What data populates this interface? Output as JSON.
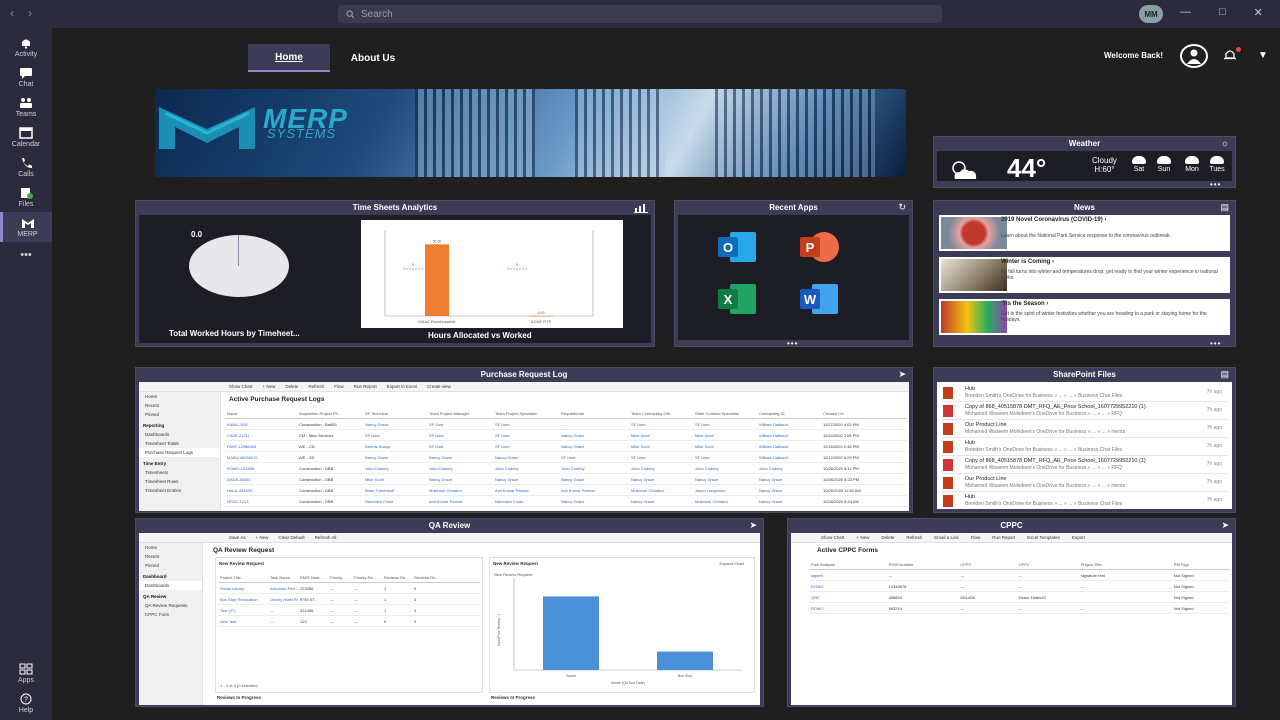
{
  "search": {
    "placeholder": "Search"
  },
  "user": {
    "initials": "MM"
  },
  "rail": [
    {
      "label": "Activity",
      "icon": "bell-icon"
    },
    {
      "label": "Chat",
      "icon": "chat-icon"
    },
    {
      "label": "Teams",
      "icon": "teams-icon"
    },
    {
      "label": "Calendar",
      "icon": "calendar-icon"
    },
    {
      "label": "Calls",
      "icon": "phone-icon"
    },
    {
      "label": "Files",
      "icon": "files-icon"
    },
    {
      "label": "MERP",
      "icon": "merp-icon"
    },
    {
      "label": "Apps",
      "icon": "apps-icon"
    },
    {
      "label": "Help",
      "icon": "help-icon"
    }
  ],
  "nav": {
    "home": "Home",
    "about": "About Us"
  },
  "header": {
    "welcome": "Welcome Back!"
  },
  "banner": {
    "brand": "MERP",
    "sub": "SYSTEMS"
  },
  "weather": {
    "title": "Weather",
    "temp": "44°",
    "condition": "Cloudy",
    "high": "H:60°",
    "forecast": [
      "Sat",
      "Sun",
      "Mon",
      "Tues"
    ]
  },
  "timesheets": {
    "title": "Time Sheets Analytics",
    "pie_value": "0.0",
    "pie_title": "Total Worked Hours by Timeheet...",
    "bar_title": "Hours Allocated vs Worked",
    "chart_data": {
      "type": "bar",
      "categories": [
        "MAAC Reimbursable",
        "ACHE RTS"
      ],
      "series": [
        {
          "name": "",
          "values": [
            50,
            0.1
          ]
        }
      ],
      "annotations": [
        "0",
        "0",
        "50.00",
        "0.00"
      ],
      "ylim": [
        0,
        60
      ]
    }
  },
  "recent_apps": {
    "title": "Recent Apps",
    "apps": [
      {
        "name": "Outlook",
        "letter": "O",
        "color": "#0f6cbd"
      },
      {
        "name": "PowerPoint",
        "letter": "P",
        "color": "#c43e1c"
      },
      {
        "name": "Excel",
        "letter": "X",
        "color": "#107c41"
      },
      {
        "name": "Word",
        "letter": "W",
        "color": "#185abd"
      }
    ]
  },
  "news": {
    "title": "News",
    "items": [
      {
        "headline": "2019 Novel Coronavirus (COVID-19) ›",
        "desc": "Learn about the National Park Service response to the coronavirus outbreak."
      },
      {
        "headline": "Winter is Coming ›",
        "desc": "As fall turns into winter and temperatures drop, get ready to find your winter experience in national parks."
      },
      {
        "headline": "'Tis the Season ›",
        "desc": "Get in the spirit of winter festivities whether you are heading to a park or staying home for the holidays."
      }
    ]
  },
  "purchase": {
    "title": "Purchase Request Log",
    "view": "Active Purchase Request Logs",
    "commands": [
      "Show Chart",
      "+ New",
      "Delete",
      "Refresh",
      "Flow",
      "Run Report",
      "Export to Excel",
      "Create view"
    ],
    "sidebar": [
      "Home",
      "Recent",
      "Pinned",
      "Reporting",
      "Dashboards",
      "Timesheet Totals",
      "Purchase Request Logs",
      "Time Entry",
      "Timesheets",
      "Timesheet Rows",
      "Timesheet Entries"
    ],
    "columns": [
      "Name",
      "Acquisition Project Ph...",
      "SF Technical",
      "Team Project Manager",
      "Team Project Specialist",
      "Requisitioner",
      "Team Contracting Offi...",
      "State Contract Specialist",
      "Contracting ID",
      "Created On"
    ],
    "rows": [
      [
        "KABA-7452",
        "Construction - Ba655",
        "Nancy Grace",
        "SF User",
        "SF User",
        "---",
        "SF User",
        "SF User",
        "William Dalbault",
        "11/27/2020 4:03 PM"
      ],
      [
        "CAVE-21211",
        "CM - Misc Services",
        "SF User",
        "SF User",
        "SF User",
        "Nancy Grace",
        "Mike Scott",
        "Mike Scott",
        "William Dalbault",
        "11/24/2020 1:06 PM"
      ],
      [
        "PAVE-12986455",
        "A/E - CD",
        "Dennis Knapp",
        "SF User",
        "SF User",
        "Nancy Grace",
        "Mike Scott",
        "Mike Scott",
        "William Dalbault",
        "11/16/2020 2:46 PM"
      ],
      [
        "MABU-45000070",
        "A/E - SD",
        "Nancy Grace",
        "Nancy Grace",
        "Nancy Grace",
        "SF User",
        "SF User",
        "SF User",
        "William Dalbault",
        "11/12/2020 6:29 PM"
      ],
      [
        "ROMO-123456",
        "Construction - DBB",
        "John Chaney",
        "John Chaney",
        "John Chaney",
        "John Chaney",
        "John Chaney",
        "John Chaney",
        "John Chaney",
        "10/26/2020 8:11 PM"
      ],
      [
        "DADA-45464",
        "Construction - DBB",
        "Mike Scott",
        "Nancy Grace",
        "Nancy Grace",
        "Nancy Grace",
        "Nancy Grace",
        "Nancy Grace",
        "Nancy Grace",
        "10/26/2020 8:23 PM"
      ],
      [
        "HALA-45464S",
        "Construction - DBB",
        "Brian Turkenhoff",
        "Mukbosh Chhabra",
        "Anil Kumar Parmar",
        "Anil Kumar Parmar",
        "Mukbosh Chhabra",
        "Jason Longshore",
        "Nancy Grace",
        "10/26/2020 11:50 AM"
      ],
      [
        "HPDC-1214",
        "Construction - DBB",
        "Narendra Chute",
        "Anil Kumar Parmar",
        "Narendra Chute",
        "Nancy Grace",
        "Nancy Grace",
        "Mukbosh Chhabra",
        "Nancy Grace",
        "10/26/2020 8:44 AM"
      ]
    ]
  },
  "sharepoint": {
    "title": "SharePoint Files",
    "items": [
      {
        "name": "Hub",
        "sub": "Brenden Smith's OneDrive for Business » ... » ... » Business Chat Files",
        "time": "7h ago",
        "type": "ppt"
      },
      {
        "name": "Copy of 868_40515878 DMT_RFQ_AE_Price School_1607729952210 (1)",
        "sub": "Mohamed Waseem Mohideen's OneDrive for Business » ... » ... » RFQ",
        "time": "7h ago",
        "type": "pdf"
      },
      {
        "name": "Our Product Line",
        "sub": "Mohamed Waseem Mohideen's OneDrive for Business » ... » ... » ments",
        "time": "7h ago",
        "type": "ppt"
      },
      {
        "name": "Hub",
        "sub": "Brenden Smith's OneDrive for Business » ... » ... » Business Chat Files",
        "time": "7h ago",
        "type": "ppt"
      },
      {
        "name": "Copy of 868_40515878 DMT_RFQ_AE_Price School_1607729952210 (1)",
        "sub": "Mohamed Waseem Mohideen's OneDrive for Business » ... » ... » RFQ",
        "time": "7h ago",
        "type": "pdf"
      },
      {
        "name": "Our Product Line",
        "sub": "Mohamed Waseem Mohideen's OneDrive for Business » ... » ... » ments",
        "time": "7h ago",
        "type": "ppt"
      },
      {
        "name": "Hub",
        "sub": "Brenden Smith's OneDrive for Business » ... » ... » Business Chat Files",
        "time": "7h ago",
        "type": "ppt"
      }
    ]
  },
  "qa": {
    "title": "QA Review",
    "view": "QA Review Request",
    "commands": [
      "Save As",
      "+ New",
      "Clear Default",
      "Refresh All"
    ],
    "sidebar": [
      "Home",
      "Recent",
      "Pinned",
      "Dashboard",
      "Dashboards",
      "QA Review",
      "QA Review Requests",
      "CPPC Form"
    ],
    "panel_left": "New Review Request",
    "panel_right": "New Review Request",
    "expand": "Expand Chart",
    "columns": [
      "Project Title",
      "Task Name",
      "PMIS Num...",
      "Priority",
      "Priority Re...",
      "Reviews Re...",
      "Reviews Re..."
    ],
    "rows": [
      [
        "Social Library",
        "Advocate Fert...",
        "123456",
        "---",
        "---",
        "1",
        "0"
      ],
      [
        "Bus Stop Renovation",
        "Disney Hotel Re...",
        "RTM ET...",
        "---",
        "---",
        "1",
        "0"
      ],
      [
        "Test (47)",
        "---",
        "321456",
        "---",
        "---",
        "1",
        "0"
      ],
      [
        "New Test",
        "---",
        "123",
        "---",
        "---",
        "0",
        "0"
      ]
    ],
    "count": "1 - 4 of 4 (0 selected)",
    "bottom_left": "Reviews In Progress",
    "bottom_right": "Reviews In Progress",
    "chart_data": {
      "type": "bar",
      "title": "New Review Request",
      "categories": [
        "Social",
        "Bus Stop"
      ],
      "series": [
        {
          "name": "",
          "values": [
            4,
            1
          ]
        }
      ],
      "xlabel": "Month (QA Due Date)",
      "ylabel": "Sum(Prior Review...)",
      "ylim": [
        0,
        5
      ]
    }
  },
  "cppc": {
    "title": "CPPC",
    "view": "Active CPPC Forms",
    "commands": [
      "Show Chart",
      "+ New",
      "Delete",
      "Refresh",
      "Email a Link",
      "Flow",
      "Run Report",
      "Excel Templates",
      "Export"
    ],
    "columns": [
      "Park Analysis",
      "PMIS Number",
      "CPPC",
      "CPPC",
      "Project Title",
      "PM Sign"
    ],
    "rows": [
      [
        "signed",
        "---",
        "---",
        "---",
        "signature test",
        "Not Signed"
      ],
      [
        "ROMO",
        "12345678",
        "---",
        "---",
        "---",
        "Not Signed"
      ],
      [
        "QNP",
        "456654",
        "654,456",
        "Demo 16dec20",
        "",
        "Not Signed"
      ],
      [
        "ROMO",
        "963214",
        "---",
        "---",
        "---",
        "Not Signed"
      ]
    ]
  }
}
